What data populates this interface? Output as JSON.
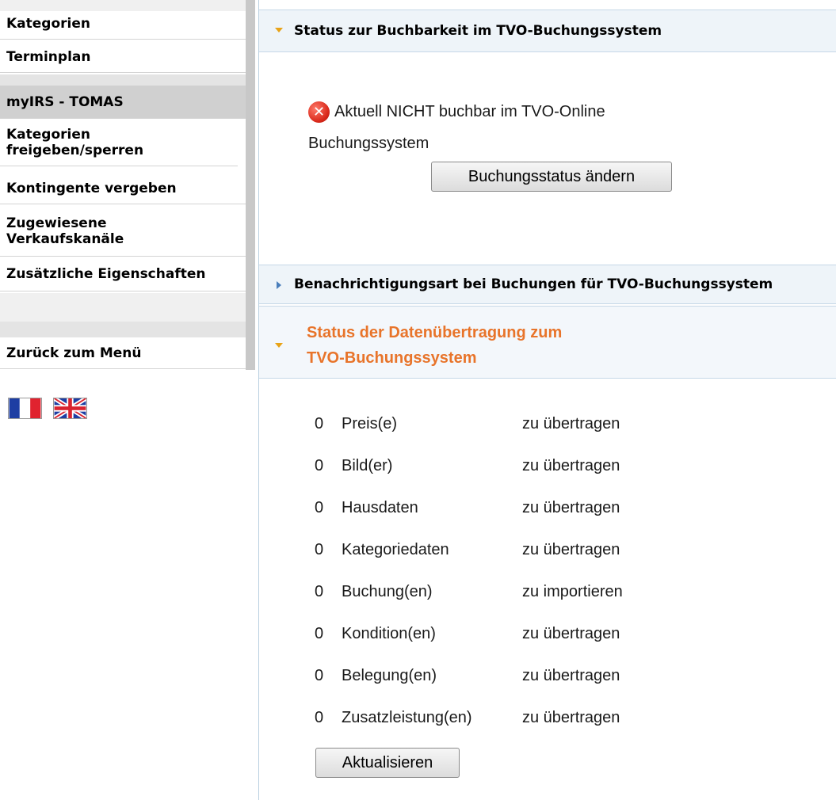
{
  "sidebar": {
    "items": [
      {
        "label": "Kategorien"
      },
      {
        "label": "Terminplan"
      },
      {
        "label": "myIRS - TOMAS"
      },
      {
        "label": "Kategorien freigeben/sperren"
      },
      {
        "label": "Kontingente vergeben"
      },
      {
        "label": "Zugewiesene Verkaufskanäle"
      },
      {
        "label": "Zusätzliche Eigenschaften"
      },
      {
        "label": "Zurück zum Menü"
      }
    ]
  },
  "flags": [
    "french-flag-icon",
    "uk-flag-icon"
  ],
  "panel_booking_status": {
    "title": "Status zur Buchbarkeit im TVO-Buchungssystem",
    "status_text_line1": "Aktuell NICHT buchbar im TVO-Online",
    "status_text_line2": "Buchungssystem",
    "change_button": "Buchungsstatus ändern"
  },
  "panel_notification": {
    "title": "Benachrichtigungsart bei Buchungen für TVO-Buchungssystem"
  },
  "panel_transfer": {
    "title_line1": "Status der Datenübertragung zum",
    "title_line2": "TVO-Buchungssystem",
    "rows": [
      {
        "count": "0",
        "item": "Preis(e)",
        "action": "zu übertragen"
      },
      {
        "count": "0",
        "item": "Bild(er)",
        "action": "zu übertragen"
      },
      {
        "count": "0",
        "item": "Hausdaten",
        "action": "zu übertragen"
      },
      {
        "count": "0",
        "item": "Kategoriedaten",
        "action": "zu übertragen"
      },
      {
        "count": "0",
        "item": "Buchung(en)",
        "action": "zu importieren"
      },
      {
        "count": "0",
        "item": "Kondition(en)",
        "action": "zu übertragen"
      },
      {
        "count": "0",
        "item": "Belegung(en)",
        "action": "zu übertragen"
      },
      {
        "count": "0",
        "item": "Zusatzleistung(en)",
        "action": "zu übertragen"
      }
    ],
    "refresh_button": "Aktualisieren"
  },
  "colors": {
    "accent_orange": "#e8742a",
    "arrow_expanded": "#e8a317",
    "arrow_collapsed": "#4a7ebb",
    "error_red": "#d9281a"
  }
}
